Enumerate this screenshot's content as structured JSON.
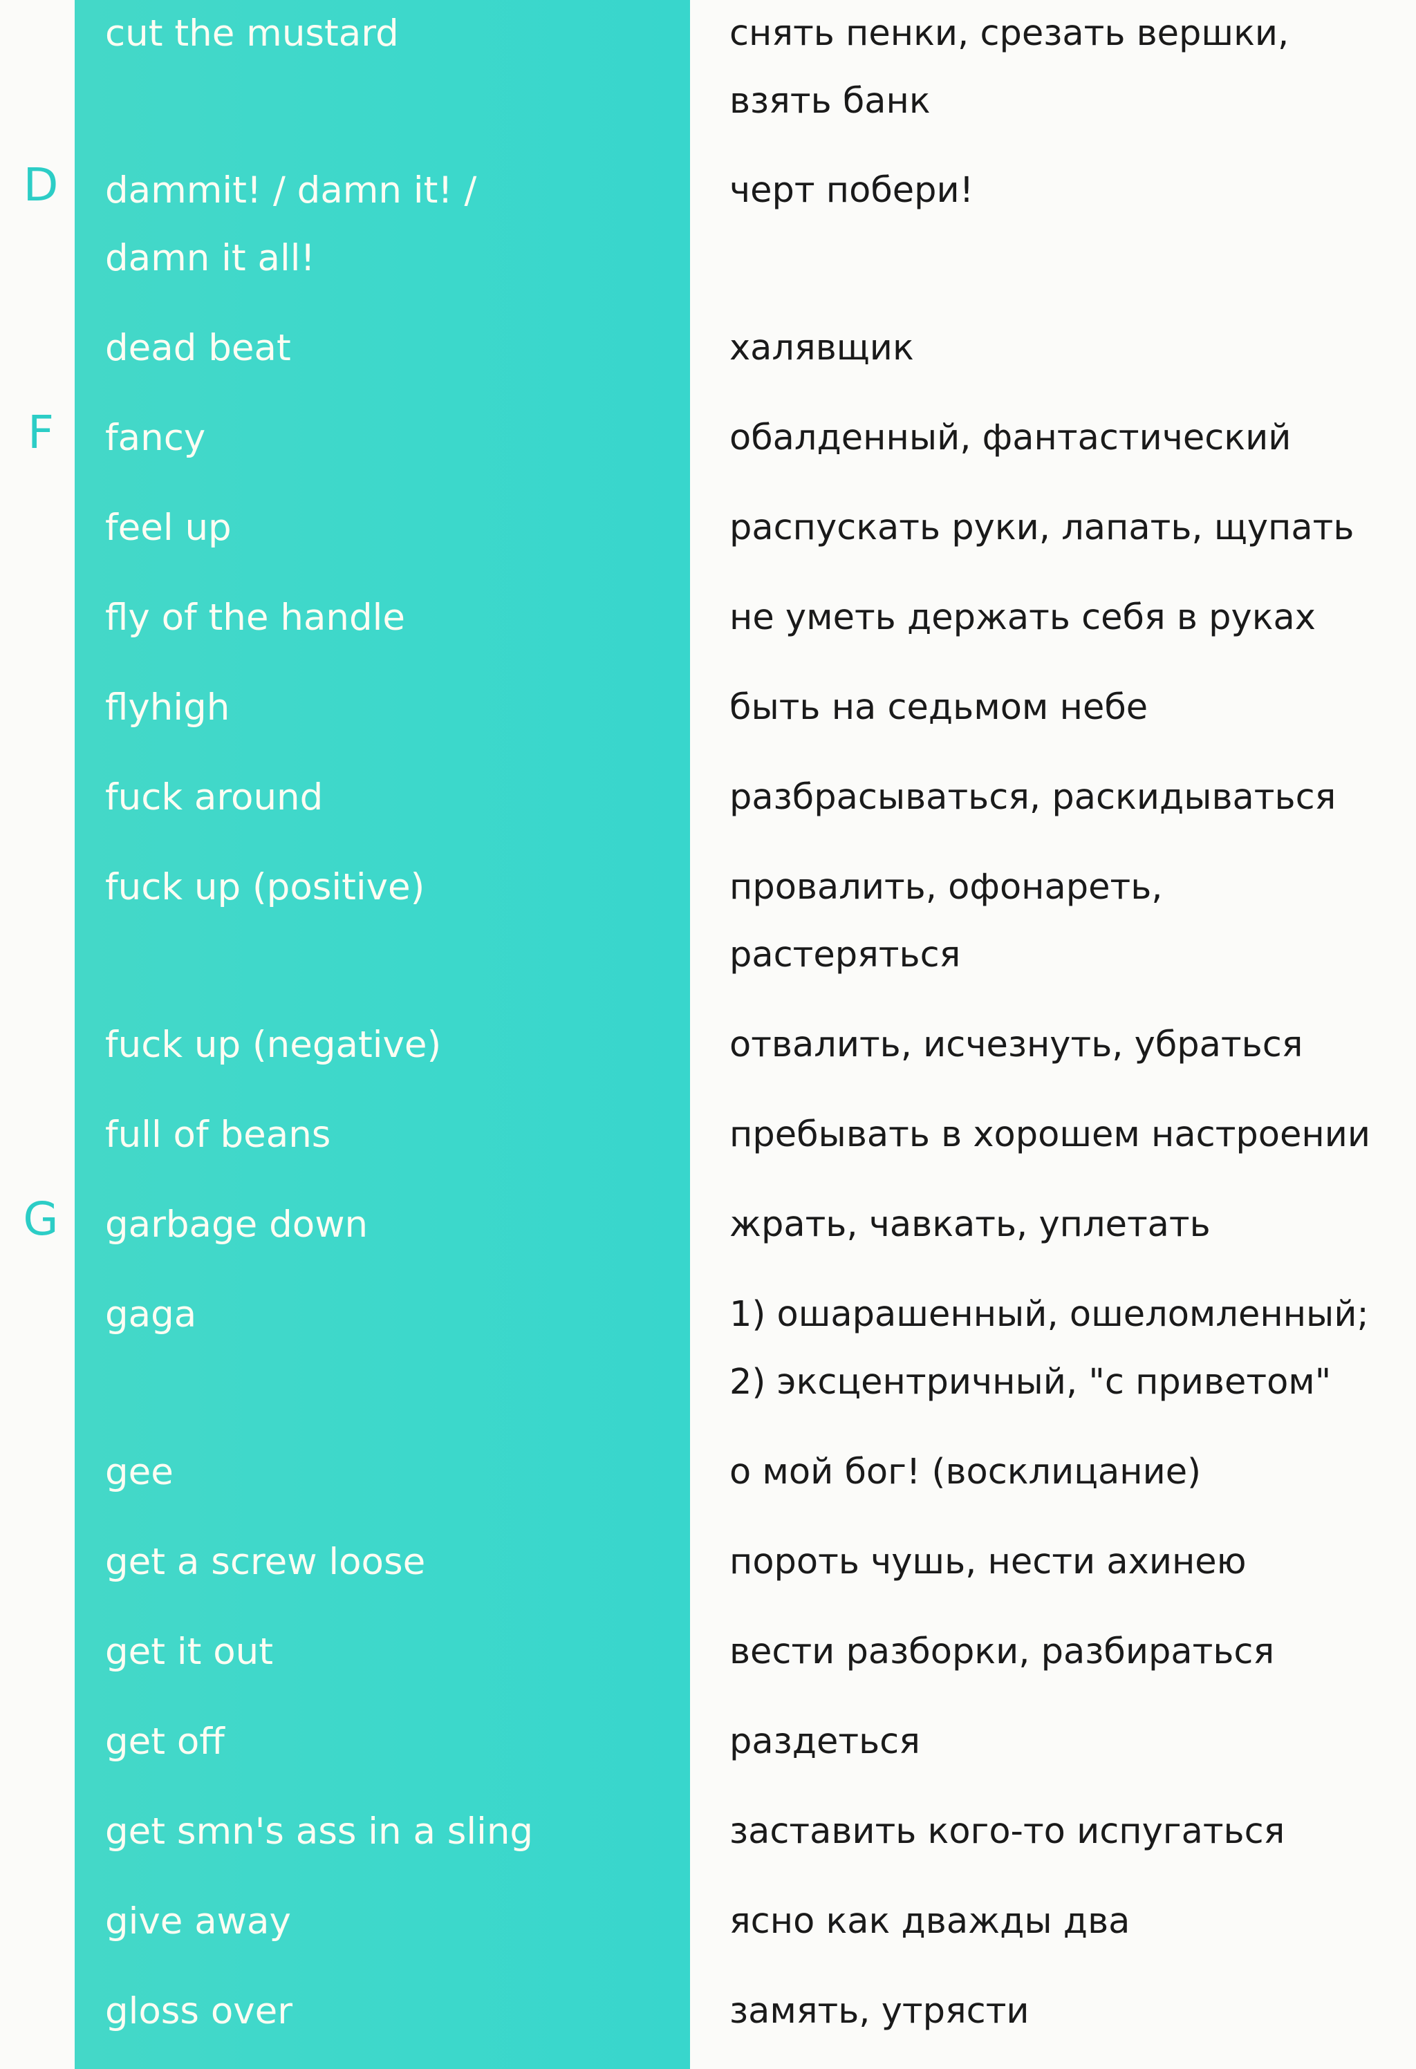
{
  "theme": {
    "band_color": "#3dd8cb",
    "letter_color": "#2ccdc6",
    "term_color": "#fdfdf3",
    "translation_color": "#1a1a1a",
    "background": "#fbfbf9"
  },
  "entries": [
    {
      "letter": "",
      "term": "cut the mustard",
      "translation": "снять пенки, срезать вершки,\nвзять банк"
    },
    {
      "letter": "D",
      "term": "dammit! / damn it! /\ndamn it all!",
      "translation": "черт побери!"
    },
    {
      "letter": "",
      "term": "dead beat",
      "translation": "халявщик"
    },
    {
      "letter": "F",
      "term": "fancy",
      "translation": "обалденный, фантастический"
    },
    {
      "letter": "",
      "term": "feel up",
      "translation": "распускать руки, лапать, щупать"
    },
    {
      "letter": "",
      "term": "fly of the handle",
      "translation": "не уметь держать себя в руках"
    },
    {
      "letter": "",
      "term": "flyhigh",
      "translation": "быть на седьмом небе"
    },
    {
      "letter": "",
      "term": "fuck around",
      "translation": "разбрасываться, раскидываться"
    },
    {
      "letter": "",
      "term": "fuck up (positive)",
      "translation": "провалить, офонареть,\nрастеряться"
    },
    {
      "letter": "",
      "term": "fuck up (negative)",
      "translation": "отвалить, исчезнуть, убраться"
    },
    {
      "letter": "",
      "term": "full of beans",
      "translation": "пребывать в хорошем настроении"
    },
    {
      "letter": "G",
      "term": "garbage down",
      "translation": "жрать, чавкать, уплетать"
    },
    {
      "letter": "",
      "term": "gaga",
      "translation": "1) ошарашенный, ошеломленный;\n2) эксцентричный, \"с приветом\""
    },
    {
      "letter": "",
      "term": "gee",
      "translation": "о мой бог! (восклицание)"
    },
    {
      "letter": "",
      "term": "get a screw loose",
      "translation": "пороть чушь, нести ахинею"
    },
    {
      "letter": "",
      "term": "get it out",
      "translation": "вести разборки, разбираться"
    },
    {
      "letter": "",
      "term": "get off",
      "translation": "раздеться"
    },
    {
      "letter": "",
      "term": "get smn's ass in a sling",
      "translation": "заставить кого-то испугаться"
    },
    {
      "letter": "",
      "term": "give away",
      "translation": "ясно как дважды два"
    },
    {
      "letter": "",
      "term": "gloss over",
      "translation": "замять, утрясти"
    }
  ]
}
